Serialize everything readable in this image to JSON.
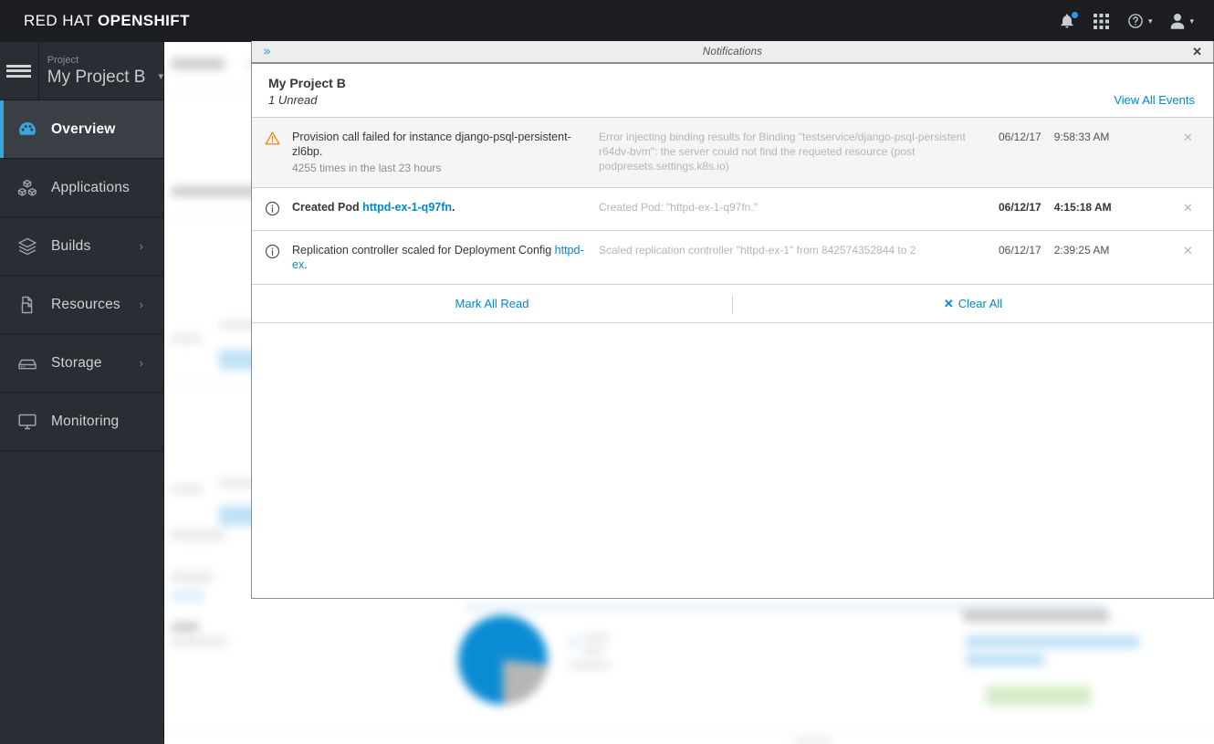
{
  "masthead": {
    "brand_prefix": "RED HAT ",
    "brand_bold": "OPENSHIFT",
    "icons": [
      {
        "name": "notification-bell-icon",
        "has_badge": true
      },
      {
        "name": "app-grid-icon",
        "has_badge": false
      },
      {
        "name": "help-icon",
        "has_badge": false
      },
      {
        "name": "user-icon",
        "has_badge": false
      }
    ]
  },
  "sidebar": {
    "hamburger": "menu-icon",
    "project": {
      "label": "Project",
      "name": "My Project B",
      "caret": "⌄"
    },
    "items": [
      {
        "label": "Overview",
        "icon": "dashboard-icon",
        "active": true,
        "chevron": ""
      },
      {
        "label": "Applications",
        "icon": "cubes-icon",
        "active": false,
        "chevron": ""
      },
      {
        "label": "Builds",
        "icon": "layers-icon",
        "active": false,
        "chevron": "›"
      },
      {
        "label": "Resources",
        "icon": "files-icon",
        "active": false,
        "chevron": "›"
      },
      {
        "label": "Storage",
        "icon": "storage-icon",
        "active": false,
        "chevron": "›"
      },
      {
        "label": "Monitoring",
        "icon": "monitor-icon",
        "active": false,
        "chevron": ""
      }
    ]
  },
  "drawer": {
    "titlebar": {
      "expand_glyph": "»",
      "title": "Notifications",
      "close_glyph": "✕"
    },
    "header": {
      "project": "My Project B",
      "unread": "1 Unread",
      "view_all": "View All Events"
    },
    "notifications": [
      {
        "icon": "warning-triangle-icon",
        "unread": true,
        "message": "Provision call failed for instance django-psql-persistent-zl6bp.",
        "message_link": "",
        "message_suffix": "",
        "sub": "4255 times in the last 23 hours",
        "detail": "Error injecting binding results for Binding \"testservice/django-psql-persistent r64dv-bvm\": the server could not find the requeted resource (post podpresets.settings.k8s.io)",
        "date": "06/12/17",
        "time": "9:58:33 AM",
        "close_glyph": "✕"
      },
      {
        "icon": "info-circle-icon",
        "unread": true,
        "message": "Created Pod ",
        "message_link": "httpd-ex-1-q97fn",
        "message_suffix": ".",
        "sub": "",
        "detail": "Created Pod: \"httpd-ex-1-q97fn.\"",
        "date": "06/12/17",
        "time": "4:15:18 AM",
        "close_glyph": "✕"
      },
      {
        "icon": "info-circle-icon",
        "unread": false,
        "message": "Replication controller scaled for Deployment Config ",
        "message_link": "httpd-ex",
        "message_suffix": ".",
        "sub": "",
        "detail": "Scaled replication controller \"httpd-ex-1\" from 842574352844 to 2",
        "date": "06/12/17",
        "time": "2:39:25 AM",
        "close_glyph": "✕"
      }
    ],
    "footer": {
      "mark_all_read": "Mark All Read",
      "clear_all": "Clear All",
      "clear_all_glyph": "✕"
    }
  },
  "colors": {
    "masthead_bg": "#1b1d21",
    "sidebar_bg": "#292e34",
    "accent_blue": "#0088ce",
    "active_blue": "#39a5dc",
    "warning_orange": "#ec7a08",
    "unread_row_bg": "#f5f5f5"
  }
}
